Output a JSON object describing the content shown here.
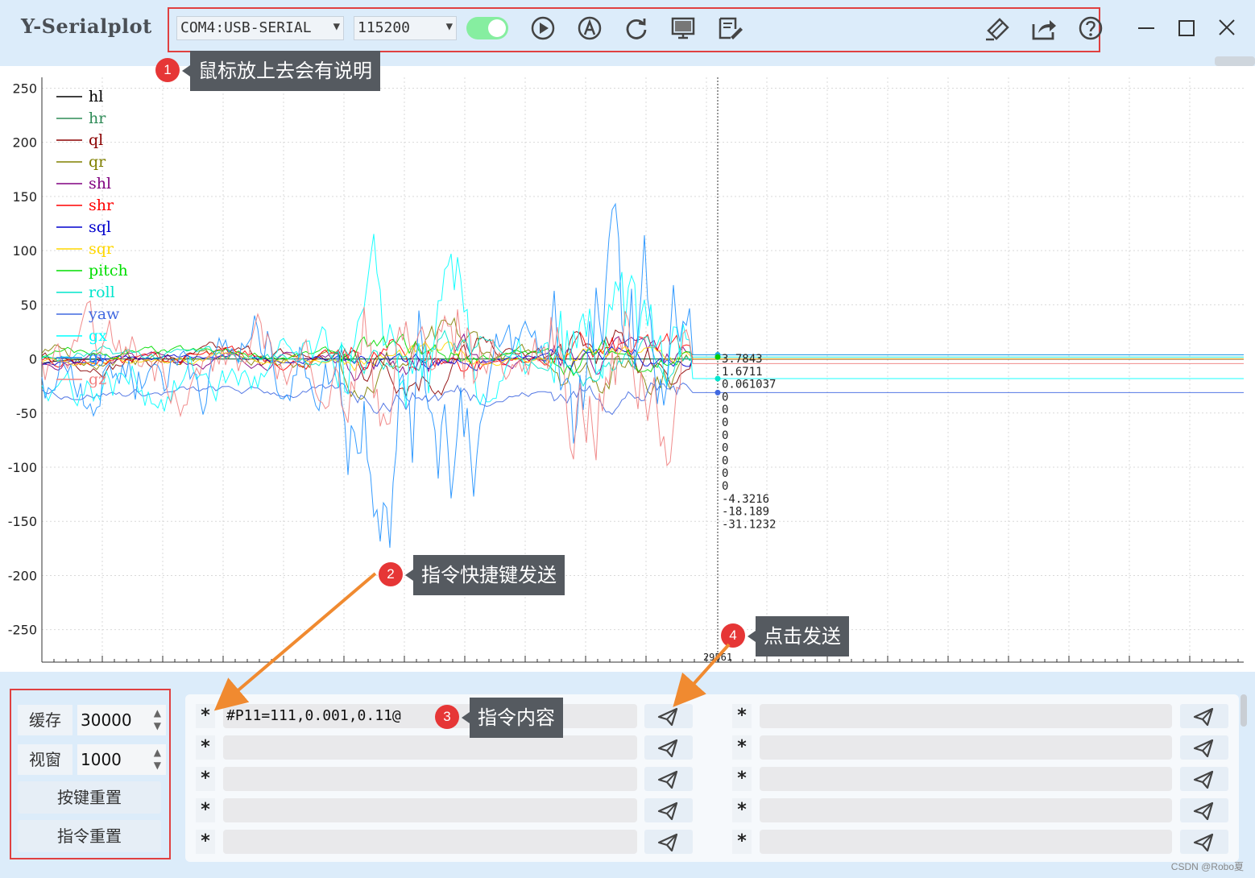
{
  "app": {
    "title": "Y-Serialplot"
  },
  "toolbar": {
    "port_value": "COM4:USB-SERIAL",
    "baud_value": "115200",
    "connect_toggle_on": true,
    "icons": [
      "play-icon",
      "auto-a-icon",
      "refresh-icon",
      "monitor-icon",
      "script-edit-icon",
      "clear-brush-icon",
      "share-export-icon",
      "help-icon"
    ]
  },
  "window_controls": [
    "minimize-icon",
    "maximize-icon",
    "close-icon"
  ],
  "callouts": {
    "c1": {
      "num": "1",
      "text": "鼠标放上去会有说明"
    },
    "c2": {
      "num": "2",
      "text": "指令快捷键发送"
    },
    "c3": {
      "num": "3",
      "text": "指令内容"
    },
    "c4": {
      "num": "4",
      "text": "点击发送"
    }
  },
  "chart_data": {
    "type": "line",
    "ylim": [
      -280,
      260
    ],
    "yticks": [
      "250",
      "200",
      "150",
      "100",
      "50",
      "0",
      "-50",
      "-100",
      "-150",
      "-200",
      "-250"
    ],
    "ytick_values": [
      250,
      200,
      150,
      100,
      50,
      0,
      -50,
      -100,
      -150,
      -200,
      -250
    ],
    "grid": true,
    "legend_position": "top-left",
    "cursor": {
      "x_label": "29561",
      "values": [
        "3.7843",
        "1.6711",
        "0.061037",
        "0",
        "0",
        "0",
        "0",
        "0",
        "0",
        "0",
        "0",
        "-4.3216",
        "-18.189",
        "-31.1232"
      ]
    },
    "series": [
      {
        "name": "hl",
        "color": "#000000"
      },
      {
        "name": "hr",
        "color": "#2e8b57"
      },
      {
        "name": "ql",
        "color": "#8b0000"
      },
      {
        "name": "qr",
        "color": "#808000"
      },
      {
        "name": "shl",
        "color": "#800080"
      },
      {
        "name": "shr",
        "color": "#ff0000"
      },
      {
        "name": "sql",
        "color": "#0000cd"
      },
      {
        "name": "sqr",
        "color": "#ffd700"
      },
      {
        "name": "pitch",
        "color": "#00dd00"
      },
      {
        "name": "roll",
        "color": "#00e5cc"
      },
      {
        "name": "yaw",
        "color": "#4169e1"
      },
      {
        "name": "gx",
        "color": "#00ffff"
      },
      {
        "name": "gy",
        "color": "#1e90ff"
      },
      {
        "name": "gz",
        "color": "#f08080"
      }
    ]
  },
  "left_panel": {
    "buffer_label": "缓存",
    "buffer_value": "30000",
    "window_label": "视窗",
    "window_value": "1000",
    "key_reset_label": "按键重置",
    "cmd_reset_label": "指令重置"
  },
  "commands": {
    "star": "*",
    "left": [
      "#P11=111,0.001,0.11@",
      "",
      "",
      "",
      ""
    ],
    "right": [
      "",
      "",
      "",
      "",
      ""
    ]
  },
  "watermark": "CSDN @Robo夏"
}
